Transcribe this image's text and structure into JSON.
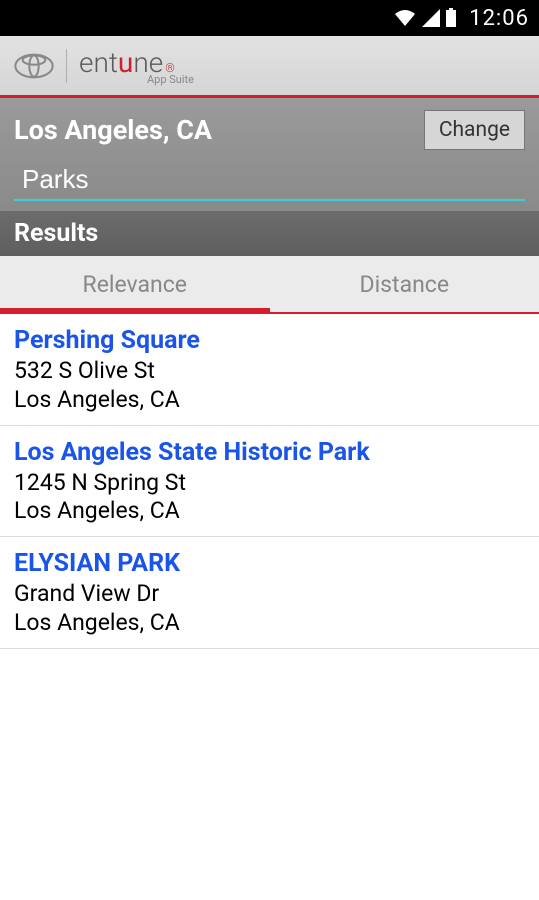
{
  "status": {
    "time": "12:06"
  },
  "brand": {
    "app_suite": "App Suite"
  },
  "location": {
    "name": "Los Angeles, CA",
    "change_label": "Change"
  },
  "search": {
    "value": "Parks"
  },
  "results_header": "Results",
  "tabs": {
    "relevance": "Relevance",
    "distance": "Distance",
    "active": "relevance"
  },
  "results": [
    {
      "name": "Pershing Square",
      "street": "532 S Olive St",
      "city": "Los Angeles, CA"
    },
    {
      "name": "Los Angeles State Historic Park",
      "street": "1245 N Spring St",
      "city": "Los Angeles, CA"
    },
    {
      "name": "ELYSIAN PARK",
      "street": "Grand View Dr",
      "city": "Los Angeles, CA"
    }
  ]
}
